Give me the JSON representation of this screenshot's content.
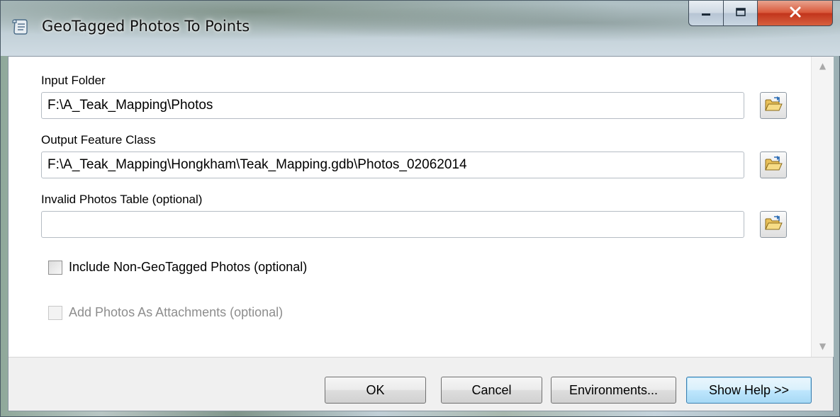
{
  "window": {
    "title": "GeoTagged Photos To Points",
    "icon": "script-tool-icon",
    "controls": [
      "minimize-icon",
      "maximize-icon",
      "close-icon"
    ]
  },
  "params": {
    "input_folder": {
      "label": "Input Folder",
      "value": "F:\\A_Teak_Mapping\\Photos"
    },
    "output_feature_class": {
      "label": "Output Feature Class",
      "value": "F:\\A_Teak_Mapping\\Hongkham\\Teak_Mapping.gdb\\Photos_02062014"
    },
    "invalid_photos_table": {
      "label": "Invalid Photos Table (optional)",
      "value": ""
    },
    "include_non_geotagged": {
      "label": "Include Non-GeoTagged Photos (optional)",
      "checked": false,
      "enabled": true
    },
    "add_photos_as_attachments": {
      "label": "Add Photos As Attachments (optional)",
      "checked": false,
      "enabled": false
    }
  },
  "buttons": {
    "ok": "OK",
    "cancel": "Cancel",
    "environments": "Environments...",
    "show_help": "Show Help >>"
  },
  "colors": {
    "close_button": "#c8442a",
    "default_button_border": "#3c7fb1",
    "disabled_text": "#8d8d8d"
  }
}
